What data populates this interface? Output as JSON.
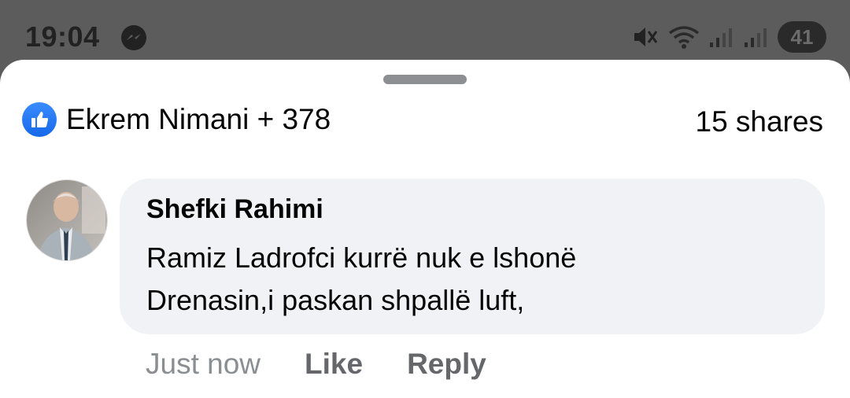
{
  "status_bar": {
    "time": "19:04",
    "battery": "41",
    "icons": [
      "messenger-icon",
      "mute-icon",
      "wifi-icon",
      "signal-icon",
      "signal-icon"
    ]
  },
  "post": {
    "reactions_text": "Ekrem Nimani + 378",
    "shares_text": "15 shares"
  },
  "comment": {
    "author": "Shefki Rahimi",
    "line1": "Ramiz Ladrofci kurrë nuk e lshonë",
    "line2": "Drenasin,i paskan shpallë luft,",
    "time": "Just now",
    "like_label": "Like",
    "reply_label": "Reply"
  },
  "colors": {
    "accent": "#1877f2",
    "bubble": "#f0f2f5",
    "muted_text": "#65676b"
  }
}
